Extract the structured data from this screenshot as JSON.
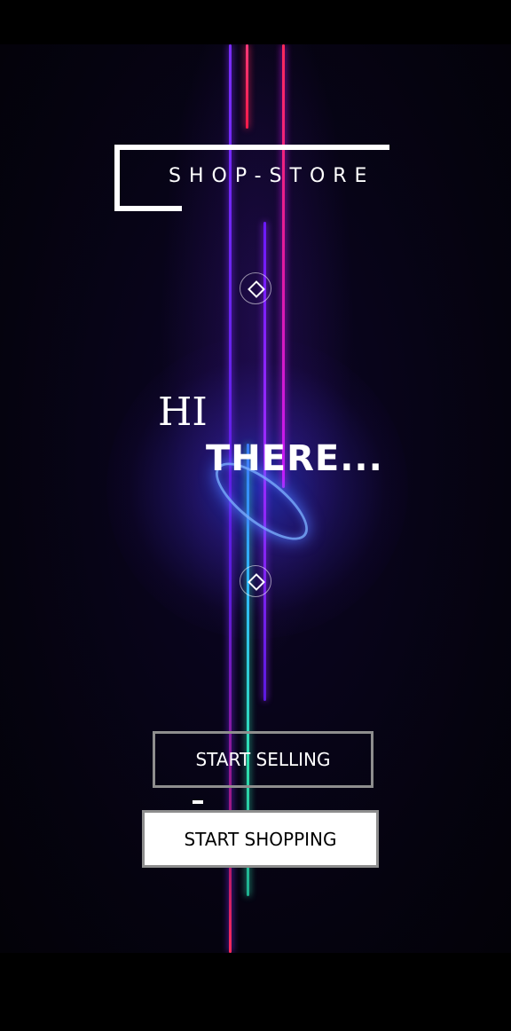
{
  "app": {
    "brand": "SHOP-STORE"
  },
  "hero": {
    "line1": "HI",
    "line2": "THERE..."
  },
  "actions": {
    "sell_label": "START SELLING",
    "shop_label": "START SHOPPING"
  },
  "colors": {
    "background": "#05030f",
    "neon_red": "#ff2a5a",
    "neon_purple": "#9b2cff",
    "neon_magenta": "#d81aff",
    "neon_teal": "#2fe0b0",
    "accent_blue": "#3a6bff"
  }
}
